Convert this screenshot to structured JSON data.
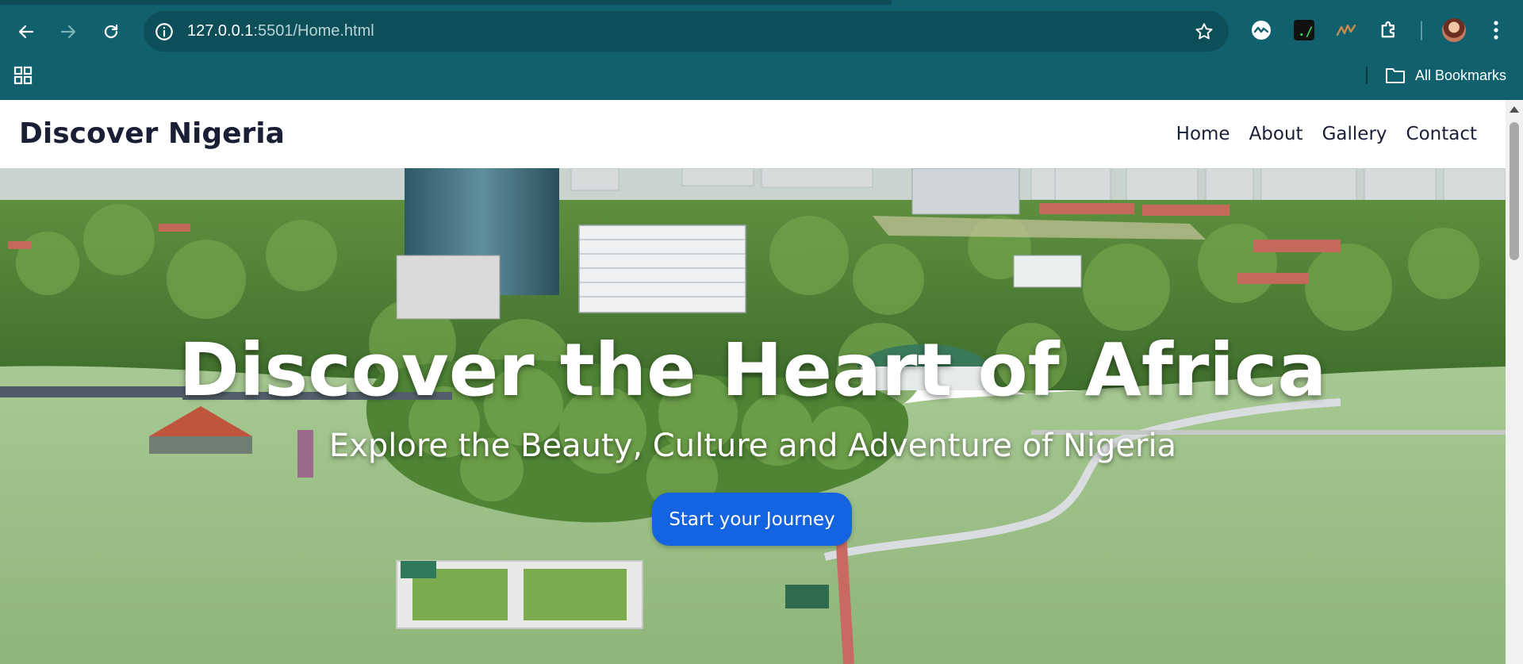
{
  "browser": {
    "url_host": "127.0.0.1",
    "url_rest": ":5501/Home.html",
    "all_bookmarks_label": "All Bookmarks",
    "icons": {
      "back": "back-arrow-icon",
      "forward": "forward-arrow-icon",
      "reload": "reload-icon",
      "site_info": "info-icon",
      "bookmark_star": "star-icon",
      "apps": "apps-grid-icon",
      "folder": "folder-icon",
      "menu": "kebab-menu-icon",
      "extension_puzzle": "puzzle-icon"
    },
    "colors": {
      "chrome_bg": "#10606d",
      "omnibox_bg": "#0d4f59"
    }
  },
  "site": {
    "logo": "Discover Nigeria",
    "nav": [
      "Home",
      "About",
      "Gallery",
      "Contact"
    ],
    "hero": {
      "title": "Discover the Heart of Africa",
      "subtitle": "Explore the Beauty, Culture and Adventure of Nigeria",
      "cta_label": "Start your Journey"
    },
    "colors": {
      "text_dark": "#1a1f36",
      "cta_blue": "#1463e0",
      "lake_green": "#9cbf86"
    }
  }
}
